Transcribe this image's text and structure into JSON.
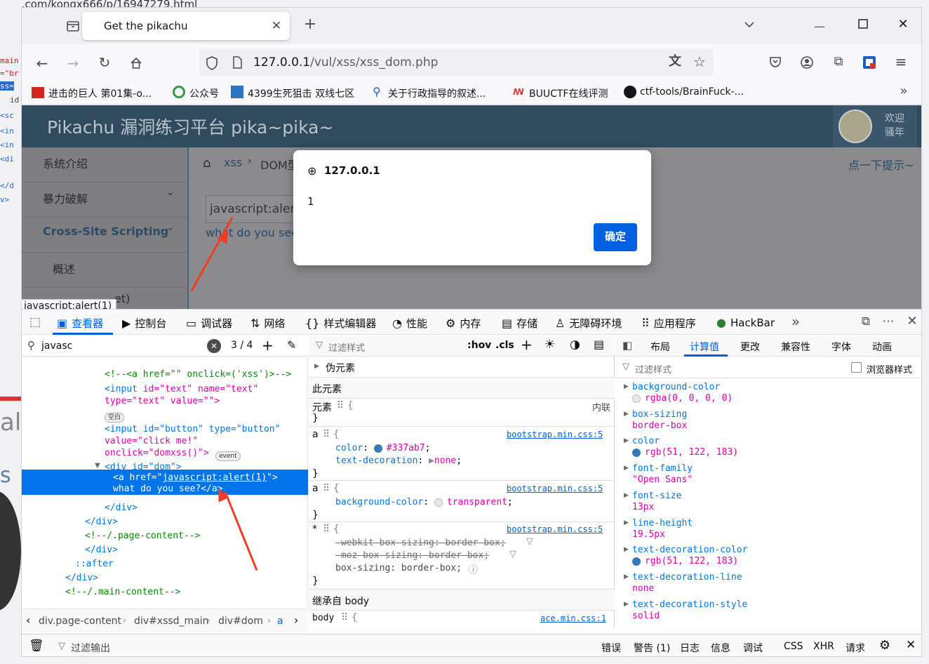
{
  "background": {
    "left_fragments": [
      "logs.com/kongx666/p/16947279.html",
      "main",
      "=\"br",
      "ss=",
      "id",
      "<sc",
      "<in",
      "<in",
      "<di",
      "</d",
      "v>",
      "ale",
      "s"
    ]
  },
  "browser": {
    "tab_title": "Get the pikachu",
    "url_host": "127.0.0.1",
    "url_path": "/vul/xss/xss_dom.php",
    "bookmarks": [
      "进击的巨人 第01集-o...",
      "公众号",
      "4399生死狙击 双线七区",
      "关于行政指导的叙述...",
      "BUUCTF在线评测",
      "ctf-tools/BrainFuck-..."
    ]
  },
  "page": {
    "title": "Pikachu 漏洞练习平台 pika~pika~",
    "welcome": "欢迎",
    "user": "骚年",
    "breadcrumb_xss": "xss",
    "breadcrumb_current": "DOM型",
    "hint_link": "点一下提示~",
    "sidebar": [
      "系统介绍",
      "暴力破解",
      "Cross-Site Scripting",
      "概述",
      "et)"
    ],
    "input_value": "javascript:alert",
    "result_link": "what do you see?",
    "hover_tooltip": "javascript:alert(1)"
  },
  "dialog": {
    "origin": "127.0.0.1",
    "message": "1",
    "ok_label": "确定"
  },
  "devtools": {
    "tabs": [
      "查看器",
      "控制台",
      "调试器",
      "网络",
      "样式编辑器",
      "性能",
      "内存",
      "存储",
      "无障碍环境",
      "应用程序",
      "HackBar"
    ],
    "search_value": "javasc",
    "search_count": "3 / 4",
    "markup": {
      "comment1": "<!--<a href=\"\" onclick=('xss')>-->",
      "input1_line1_tag": "<input",
      "input1_line1_attrs": " id=\"text\" name=\"text\"",
      "input1_line2": "type=\"text\" value=\"\">",
      "whitespace_badge": "空白",
      "input2_line1": "<input id=\"button\" type=\"button\"",
      "input2_line2": "value=\"click me!\"",
      "input2_line3": "onclick=\"domxss()\">",
      "event_badge": "event",
      "div_dom": "<div id=\"dom\">",
      "sel_line1_pre": "<a href=\"",
      "sel_line1_link": "javascript:alert(1)",
      "sel_line1_post": "\">",
      "sel_line2": "what do you see?</a>",
      "close_div1": "</div>",
      "close_div2": "</div>",
      "comment_page": "<!--/.page-content-->",
      "close_div3": "</div>",
      "after": "::after",
      "close_div4": "</div>",
      "comment_main": "<!--/.main-content-->"
    },
    "breadcrumbs": [
      "div.page-content",
      "div#xssd_main",
      "div#dom",
      "a"
    ],
    "rules": {
      "filter_placeholder": "过滤样式",
      "hov": ":hov",
      "cls": ".cls",
      "pseudo": "伪元素",
      "this_element": "此元素",
      "element_label": "元素",
      "inline": "内联",
      "source": "bootstrap.min.css:5",
      "color_prop": "color",
      "color_val": "#337ab7",
      "td_prop": "text-decoration",
      "td_val": "none",
      "bg_prop": "background-color",
      "bg_val": "transparent",
      "wk": "-webkit-box-sizing: border-box;",
      "moz": "-moz-box-sizing: border-box;",
      "bs": "box-sizing: border-box;",
      "inherited": "继承自 body",
      "body_sel": "body",
      "ace_source": "ace.min.css:1"
    },
    "computed_tabs": [
      "布局",
      "计算值",
      "更改",
      "兼容性",
      "字体",
      "动画"
    ],
    "computed_filter": "过滤样式",
    "browser_styles": "浏览器样式",
    "computed": [
      {
        "prop": "background-color",
        "val": "rgba(0, 0, 0, 0)"
      },
      {
        "prop": "box-sizing",
        "val": "border-box"
      },
      {
        "prop": "color",
        "val": "rgb(51, 122, 183)"
      },
      {
        "prop": "font-family",
        "val": "\"Open Sans\""
      },
      {
        "prop": "font-size",
        "val": "13px"
      },
      {
        "prop": "line-height",
        "val": "19.5px"
      },
      {
        "prop": "text-decoration-color",
        "val": "rgb(51, 122, 183)"
      },
      {
        "prop": "text-decoration-line",
        "val": "none"
      },
      {
        "prop": "text-decoration-style",
        "val": "solid"
      }
    ],
    "console": {
      "filter": "过滤输出",
      "levels": [
        "错误",
        "警告 (1)",
        "日志",
        "信息",
        "调试"
      ],
      "types": [
        "CSS",
        "XHR",
        "请求"
      ]
    }
  },
  "colors": {
    "accent": "#0060df",
    "link_blue": "#337ab7",
    "arrow_red": "#f03c24",
    "header_dark": "#304a5e"
  }
}
